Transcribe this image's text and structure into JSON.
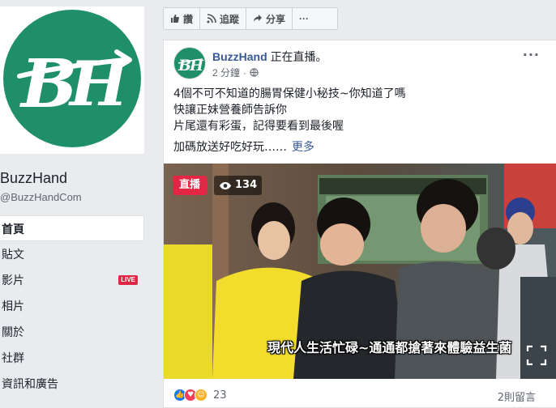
{
  "page": {
    "name": "BuzzHand",
    "handle": "@BuzzHandCom",
    "logo_text": "BH",
    "brand_color": "#1f8f6a"
  },
  "nav": {
    "items": [
      {
        "label": "首頁",
        "active": true
      },
      {
        "label": "貼文"
      },
      {
        "label": "影片",
        "badge": "LIVE"
      },
      {
        "label": "相片"
      },
      {
        "label": "關於"
      },
      {
        "label": "社群"
      },
      {
        "label": "資訊和廣告"
      }
    ]
  },
  "actions": {
    "like": "讚",
    "follow": "追蹤",
    "share": "分享",
    "more": "···"
  },
  "post": {
    "author": "BuzzHand",
    "status": "正在直播。",
    "time": "2 分鐘",
    "privacy_icon": "globe-icon",
    "more": "···",
    "lines": [
      "4個不可不知道的腸胃保健小秘技~你知道了嗎",
      "快讓正妹營養師告訴你",
      "片尾還有彩蛋，記得要看到最後喔"
    ],
    "extra_line": "加碼放送好吃好玩……",
    "more_link": "更多"
  },
  "video": {
    "live_label": "直播",
    "viewer_count": "134",
    "subtitle": "現代人生活忙碌~通通都搶著來體驗益生菌"
  },
  "reactions": {
    "count": "23",
    "comments": "2則留言",
    "types": [
      "like",
      "love",
      "haha"
    ]
  },
  "colors": {
    "accent": "#365899",
    "live": "#e42645",
    "background": "#e9ebee"
  }
}
